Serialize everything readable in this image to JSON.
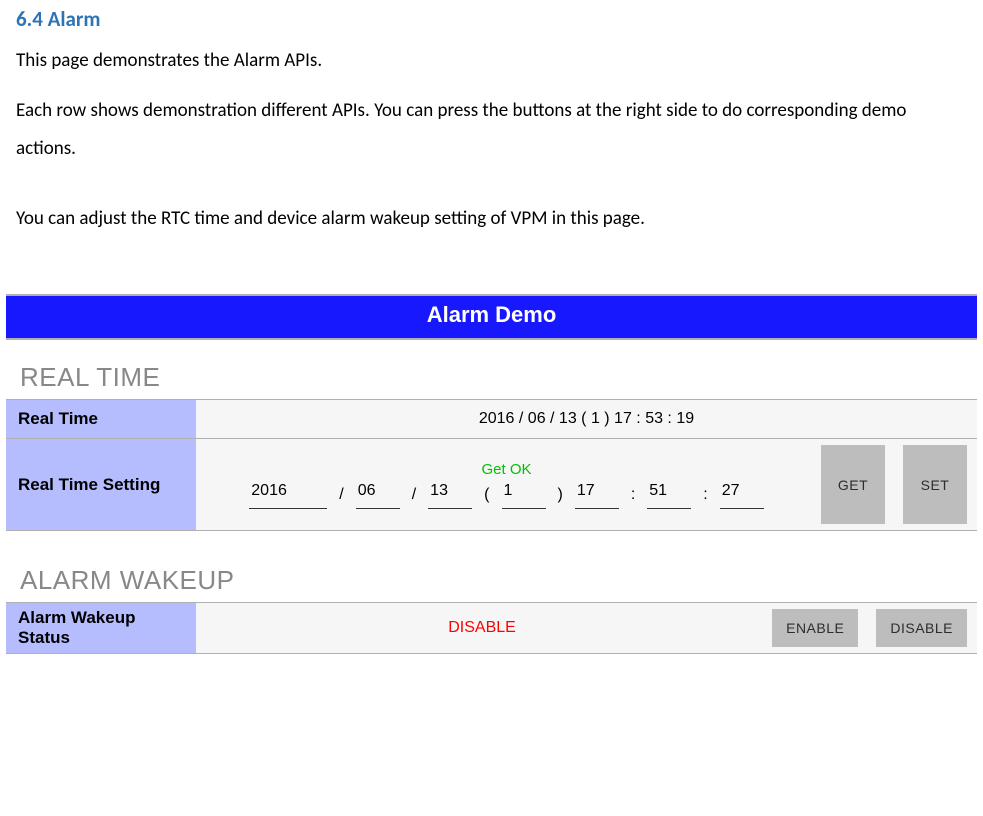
{
  "heading": "6.4 Alarm",
  "para1": "This page demonstrates the Alarm APIs.",
  "para2": "Each row shows demonstration different APIs. You can press the buttons at the right side to do corresponding demo actions.",
  "para3": "You can adjust the RTC time and device alarm wakeup setting of VPM in this page.",
  "demo": {
    "title": "Alarm Demo",
    "sections": {
      "real_time": {
        "header": "REAL TIME",
        "rows": {
          "rt_display": {
            "label": "Real Time",
            "value": "2016 / 06 / 13 ( 1 )  17 : 53 : 19"
          },
          "rt_setting": {
            "label": "Real Time Setting",
            "status": "Get OK",
            "fields": {
              "year": "2016",
              "month": "06",
              "day": "13",
              "weekday": "1",
              "hour": "17",
              "minute": "51",
              "second": "27"
            },
            "buttons": {
              "get": "GET",
              "set": "SET"
            }
          }
        }
      },
      "alarm_wakeup": {
        "header": "ALARM WAKEUP",
        "rows": {
          "status": {
            "label": "Alarm Wakeup Status",
            "value": "DISABLE",
            "buttons": {
              "enable": "ENABLE",
              "disable": "DISABLE"
            }
          }
        }
      }
    }
  }
}
